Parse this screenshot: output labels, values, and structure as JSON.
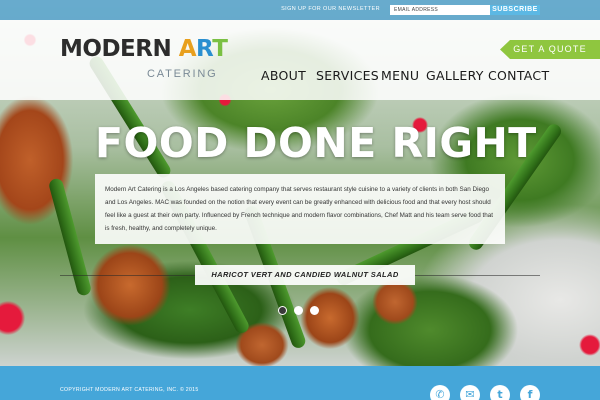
{
  "topbar": {
    "newsletter_label": "SIGN UP FOR OUR NEWSLETTER",
    "email_placeholder": "EMAIL ADDRESS",
    "subscribe_label": "SUBSCRIBE"
  },
  "header": {
    "logo_modern": "MODERN ",
    "logo_art": [
      "A",
      "R",
      "T"
    ],
    "logo_sub": "CATERING",
    "quote_label": "GET A QUOTE",
    "nav": [
      "ABOUT",
      "SERVICES",
      "MENU",
      "GALLERY",
      "CONTACT"
    ]
  },
  "hero": {
    "title": "FOOD DONE RIGHT",
    "text": "Modern Art Catering is a Los Angeles based catering company that serves restaurant style cuisine to a variety of clients in both San Diego and Los Angeles. MAC was founded on the notion that every event can be greatly enhanced with delicious food and that every host should feel like a guest at their own party. Influenced by French technique and modern flavor combinations, Chef Matt and his team serve food that is fresh, healthy, and completely unique.",
    "caption": "HARICOT VERT AND CANDIED WALNUT SALAD"
  },
  "slider": {
    "count": 3,
    "active": 1
  },
  "footer": {
    "copyright": "COPYRIGHT MODERN ART CATERING, INC. © 2015",
    "social": [
      "phone-icon",
      "mail-icon",
      "twitter-icon",
      "facebook-icon"
    ]
  },
  "colors": {
    "topbar": "#469bc8",
    "subscribe": "#5cb8e4",
    "quote": "#8fc63f",
    "footer": "#45a6d9",
    "art_a": "#e8a01e",
    "art_r": "#2a8fd0",
    "art_t": "#7ac043"
  }
}
